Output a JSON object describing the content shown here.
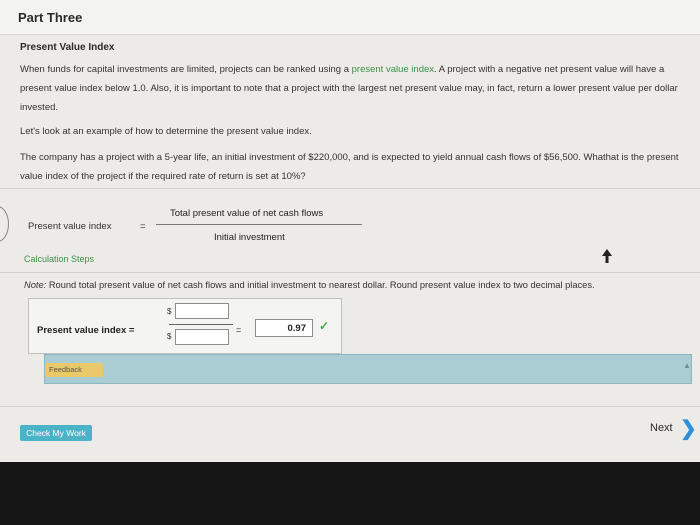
{
  "header": {
    "title": "Part Three"
  },
  "section": {
    "title": "Present Value Index"
  },
  "intro": {
    "before_link": "When funds for capital investments are limited, projects can be ranked using a ",
    "link_text": "present value index",
    "after_link": ". A project with a negative net present value will have a present value index below 1.0. Also, it is important to note that a project with the largest net present value may, in fact, return a lower present value per dollar invested."
  },
  "example_lead": "Let's look at an example of how to determine the present value index.",
  "problem": "The company has a project with a 5-year life, an initial investment of $220,000, and is expected to yield annual cash flows of $56,500. Whathat is the present value index of the project if the required rate of return is set at 10%?",
  "formula": {
    "label": "Present value index",
    "equals": "=",
    "numerator": "Total present value of net cash flows",
    "denominator": "Initial investment"
  },
  "calc_steps": "Calculation Steps",
  "note": {
    "prefix": "Note:",
    "text": " Round total present value of net cash flows and initial investment to nearest dollar. Round present value index to two decimal places."
  },
  "answer": {
    "label": "Present value index =",
    "currency": "$",
    "numerator_value": "",
    "denominator_value": "",
    "equals": "=",
    "result": "0.97",
    "check_glyph": "✓"
  },
  "feedback": {
    "label": "Feedback"
  },
  "buttons": {
    "check_work": "Check My Work",
    "next": "Next"
  },
  "colors": {
    "accent_green": "#3f8f4a",
    "feedback_bg": "#aacdd3",
    "button_bg": "#4bb3c7",
    "next_chevron": "#2f8fd8"
  }
}
